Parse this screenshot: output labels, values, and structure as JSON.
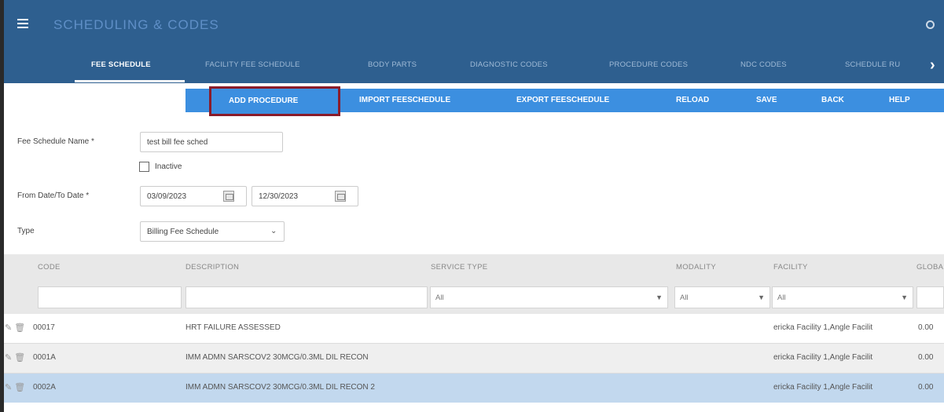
{
  "app": {
    "title": "SCHEDULING & CODES"
  },
  "tabs": [
    {
      "label": "FEE SCHEDULE",
      "active": true
    },
    {
      "label": "FACILITY FEE SCHEDULE"
    },
    {
      "label": "BODY PARTS"
    },
    {
      "label": "DIAGNOSTIC CODES"
    },
    {
      "label": "PROCEDURE CODES"
    },
    {
      "label": "NDC CODES"
    },
    {
      "label": "SCHEDULE RU"
    }
  ],
  "actions": {
    "add_procedure": "ADD PROCEDURE",
    "import": "IMPORT FEESCHEDULE",
    "export": "EXPORT FEESCHEDULE",
    "reload": "RELOAD",
    "save": "SAVE",
    "back": "BACK",
    "help": "HELP"
  },
  "form": {
    "name_label": "Fee Schedule Name *",
    "name_value": "test bill fee sched",
    "inactive_label": "Inactive",
    "date_label": "From Date/To Date *",
    "from_date": "03/09/2023",
    "to_date": "12/30/2023",
    "type_label": "Type",
    "type_value": "Billing Fee Schedule"
  },
  "grid": {
    "columns": [
      "CODE",
      "DESCRIPTION",
      "SERVICE TYPE",
      "MODALITY",
      "FACILITY",
      "GLOBAL"
    ],
    "filters": {
      "service_type": "All",
      "modality": "All",
      "facility": "All"
    },
    "rows": [
      {
        "code": "00017",
        "description": "HRT FAILURE ASSESSED",
        "facility": "ericka Facility 1,Angle Facilit",
        "global": "0.00"
      },
      {
        "code": "0001A",
        "description": "IMM ADMN SARSCOV2 30MCG/0.3ML DIL RECON",
        "facility": "ericka Facility 1,Angle Facilit",
        "global": "0.00"
      },
      {
        "code": "0002A",
        "description": "IMM ADMN SARSCOV2 30MCG/0.3ML DIL RECON 2",
        "facility": "ericka Facility 1,Angle Facilit",
        "global": "0.00",
        "selected": true
      }
    ]
  },
  "colors": {
    "header": "#2e5f8f",
    "action_bar": "#3c8fe0",
    "highlight_border": "#8a1c2b",
    "selected_row": "#c2d8ee"
  }
}
